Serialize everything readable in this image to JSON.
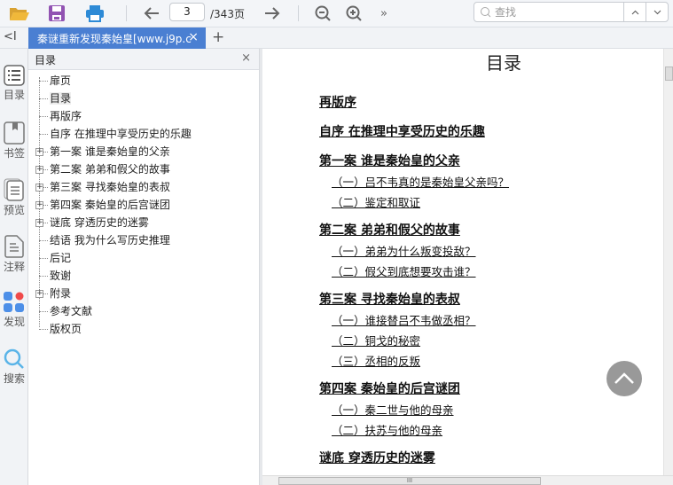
{
  "toolbar": {
    "page_current": "3",
    "page_total": "/343页",
    "search_placeholder": "查找",
    "more": "»"
  },
  "tabs": [
    {
      "label": "秦谜重新发现秦始皇[www.j9p.c",
      "close": "×"
    }
  ],
  "tab_add": "+",
  "tab_collapse": "<I",
  "rail": {
    "items": [
      {
        "label": "目录",
        "icon": "list-icon"
      },
      {
        "label": "书签",
        "icon": "bookmark-icon"
      },
      {
        "label": "预览",
        "icon": "preview-icon"
      },
      {
        "label": "注释",
        "icon": "note-icon"
      },
      {
        "label": "发现",
        "icon": "apps-icon"
      },
      {
        "label": "搜索",
        "icon": "search-icon"
      }
    ]
  },
  "toc": {
    "title": "目录",
    "close": "×",
    "items": [
      {
        "label": "扉页",
        "expandable": false
      },
      {
        "label": "目录",
        "expandable": false,
        "selected": true
      },
      {
        "label": "再版序",
        "expandable": false
      },
      {
        "label": "自序 在推理中享受历史的乐趣",
        "expandable": false
      },
      {
        "label": "第一案 谁是秦始皇的父亲",
        "expandable": true
      },
      {
        "label": "第二案 弟弟和假父的故事",
        "expandable": true
      },
      {
        "label": "第三案 寻找秦始皇的表叔",
        "expandable": true
      },
      {
        "label": "第四案 秦始皇的后宫谜团",
        "expandable": true
      },
      {
        "label": "谜底 穿透历史的迷雾",
        "expandable": true
      },
      {
        "label": "结语 我为什么写历史推理",
        "expandable": false
      },
      {
        "label": "后记",
        "expandable": false
      },
      {
        "label": "致谢",
        "expandable": false
      },
      {
        "label": "附录",
        "expandable": true
      },
      {
        "label": "参考文献",
        "expandable": false
      },
      {
        "label": "版权页",
        "expandable": false
      }
    ]
  },
  "document": {
    "title": "目录",
    "entries": [
      {
        "type": "ch",
        "text": "再版序"
      },
      {
        "type": "ch",
        "text": "自序 在推理中享受历史的乐趣"
      },
      {
        "type": "ch",
        "text": "第一案 谁是秦始皇的父亲"
      },
      {
        "type": "sub",
        "text": "（一）吕不韦真的是秦始皇父亲吗？"
      },
      {
        "type": "sub",
        "text": "（二）鉴定和取证"
      },
      {
        "type": "ch",
        "text": "第二案 弟弟和假父的故事"
      },
      {
        "type": "sub",
        "text": "（一）弟弟为什么叛变投敌？"
      },
      {
        "type": "sub",
        "text": "（二）假父到底想要攻击谁？"
      },
      {
        "type": "ch",
        "text": "第三案 寻找秦始皇的表叔"
      },
      {
        "type": "sub",
        "text": "（一）谁接替吕不韦做丞相？"
      },
      {
        "type": "sub",
        "text": "（二）铜戈的秘密"
      },
      {
        "type": "sub",
        "text": "（三）丞相的反叛"
      },
      {
        "type": "ch",
        "text": "第四案 秦始皇的后宫谜团"
      },
      {
        "type": "sub",
        "text": "（一）秦二世与他的母亲"
      },
      {
        "type": "sub",
        "text": "（二）扶苏与他的母亲"
      },
      {
        "type": "ch",
        "text": "谜底 穿透历史的迷雾"
      }
    ]
  },
  "scroll": {
    "hthumb": "III"
  }
}
